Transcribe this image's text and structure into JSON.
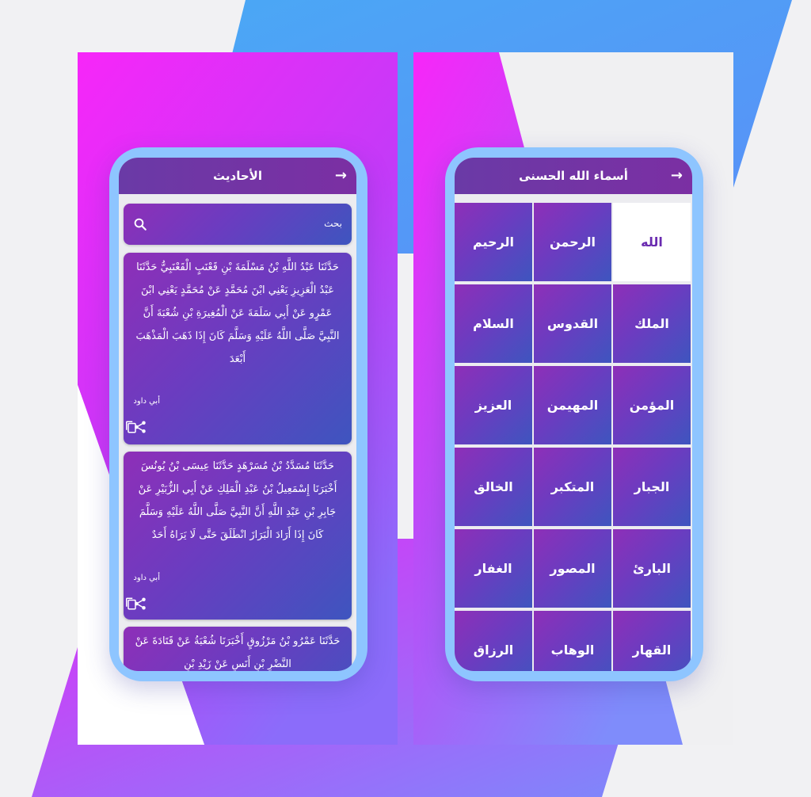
{
  "hadith_screen": {
    "title": "الأحاديث",
    "back_icon": "arrow-right-icon",
    "search_placeholder": "بحث",
    "hadiths": [
      {
        "text": "حَدَّثَنَا عَبْدُ اللَّهِ بْنُ مَسْلَمَةَ بْنِ قَعْنَبٍ الْقَعْنَبِيُّ حَدَّثَنَا عَبْدُ الْعَزِيزِ يَعْنِي ابْنَ مُحَمَّدٍ عَنْ مُحَمَّدٍ يَعْنِي ابْنَ عَمْرٍو عَنْ أَبِي سَلَمَةَ عَنْ الْمُغِيرَةِ بْنِ شُعْبَةَ أَنَّ النَّبِيَّ صَلَّى اللَّهُ عَلَيْهِ وَسَلَّمَ كَانَ إِذَا ذَهَبَ الْمَذْهَبَ أَبْعَدَ",
        "source": "أبي داود"
      },
      {
        "text": "حَدَّثَنَا مُسَدَّدُ بْنُ مُسَرْهَدٍ حَدَّثَنَا عِيسَى بْنُ يُونُسَ أَخْبَرَنَا إِسْمَعِيلُ بْنُ عَبْدِ الْمَلِكِ عَنْ أَبِي الزُّبَيْرِ عَنْ جَابِرِ بْنِ عَبْدِ اللَّهِ أَنَّ النَّبِيَّ صَلَّى اللَّهُ عَلَيْهِ وَسَلَّمَ كَانَ إِذَا أَرَادَ الْبَرَازَ انْطَلَقَ حَتَّى لَا يَرَاهُ أَحَدٌ",
        "source": "أبي داود"
      },
      {
        "text": "حَدَّثَنَا عَمْرُو بْنُ مَرْزُوقٍ أَخْبَرَنَا شُعْبَةُ عَنْ قَتَادَةَ عَنْ النَّضْرِ بْنِ أَنَسٍ عَنْ زَيْدِ بْنِ",
        "source": ""
      }
    ]
  },
  "names_screen": {
    "title": "أسماء الله الحسنى",
    "back_icon": "arrow-right-icon",
    "selected": "الله",
    "names": [
      "الله",
      "الرحمن",
      "الرحيم",
      "الملك",
      "القدوس",
      "السلام",
      "المؤمن",
      "المهيمن",
      "العزيز",
      "الجبار",
      "المتكبر",
      "الخالق",
      "البارئ",
      "المصور",
      "الغفار",
      "القهار",
      "الوهاب",
      "الرزاق"
    ]
  },
  "colors": {
    "magenta": "#f726f9",
    "blue": "#4aa8f5",
    "purple": "#7b2fa3",
    "phone_frame": "#8ec5ff"
  }
}
